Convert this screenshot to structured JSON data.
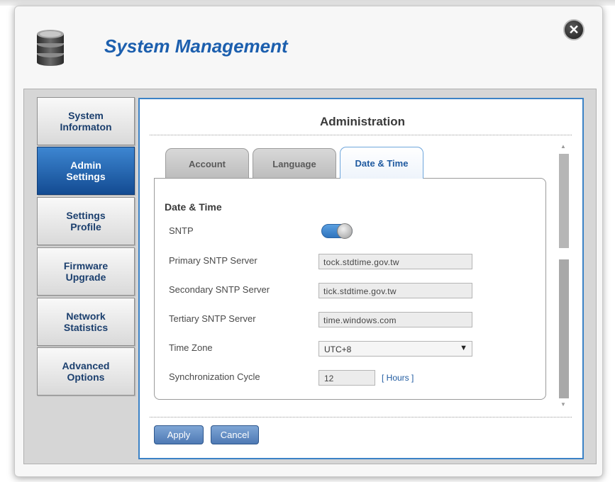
{
  "window": {
    "title": "System Management",
    "close_icon": "close-icon"
  },
  "sidebar": {
    "items": [
      {
        "label": "System\nInformaton",
        "active": false
      },
      {
        "label": "Admin\nSettings",
        "active": true
      },
      {
        "label": "Settings\nProfile",
        "active": false
      },
      {
        "label": "Firmware\nUpgrade",
        "active": false
      },
      {
        "label": "Network\nStatistics",
        "active": false
      },
      {
        "label": "Advanced\nOptions",
        "active": false
      }
    ]
  },
  "panel": {
    "title": "Administration",
    "tabs": [
      {
        "label": "Account",
        "active": false
      },
      {
        "label": "Language",
        "active": false
      },
      {
        "label": "Date & Time",
        "active": true
      }
    ],
    "section_title": "Date & Time",
    "sntp": {
      "label": "SNTP",
      "enabled": true
    },
    "primary": {
      "label": "Primary SNTP Server",
      "value": "tock.stdtime.gov.tw"
    },
    "secondary": {
      "label": "Secondary SNTP Server",
      "value": "tick.stdtime.gov.tw"
    },
    "tertiary": {
      "label": "Tertiary SNTP Server",
      "value": "time.windows.com"
    },
    "timezone": {
      "label": "Time Zone",
      "value": "UTC+8"
    },
    "sync": {
      "label": "Synchronization Cycle",
      "value": "12",
      "unit": "[ Hours ]"
    }
  },
  "buttons": {
    "apply": "Apply",
    "cancel": "Cancel"
  },
  "colors": {
    "accent": "#1c5fae",
    "active_nav": "#134b92",
    "panel_border": "#3b82c6"
  }
}
